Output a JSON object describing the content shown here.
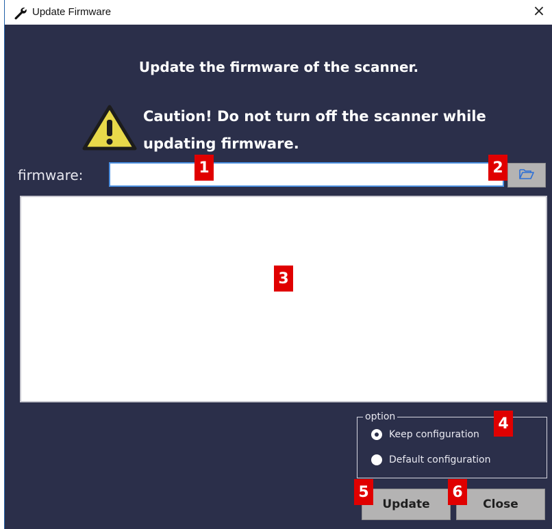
{
  "window": {
    "title": "Update Firmware",
    "title_icon": "wrench-icon",
    "close_glyph": "×"
  },
  "heading": "Update the firmware of the scanner.",
  "caution": {
    "icon": "warning-icon",
    "line1": "Caution! Do not turn off the scanner while",
    "line2": "updating firmware."
  },
  "firmware": {
    "label": "firmware:",
    "value": "",
    "browse_icon": "folder-open-icon"
  },
  "options": {
    "legend": "option",
    "items": [
      {
        "label": "Keep configuration",
        "selected": true
      },
      {
        "label": "Default configuration",
        "selected": false
      }
    ]
  },
  "buttons": {
    "update": "Update",
    "close": "Close"
  },
  "annotations": [
    "1",
    "2",
    "3",
    "4",
    "5",
    "6"
  ],
  "colors": {
    "background": "#2b2f4a",
    "badge": "#e00000",
    "button": "#b4b3b3",
    "input_border": "#4a8fe0"
  }
}
